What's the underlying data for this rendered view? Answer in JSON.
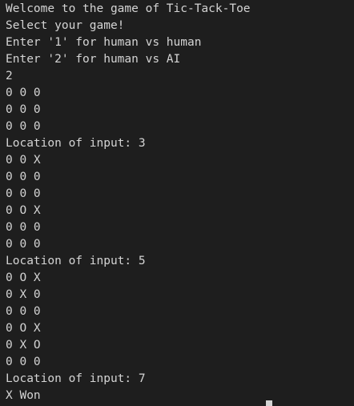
{
  "terminal": {
    "lines": [
      "Welcome to the game of Tic-Tack-Toe",
      "Select your game!",
      "Enter '1' for human vs human",
      "Enter '2' for human vs AI",
      "2",
      "0 0 0",
      "0 0 0",
      "0 0 0",
      "Location of input: 3",
      "0 0 X",
      "0 0 0",
      "0 0 0",
      "0 O X",
      "0 0 0",
      "0 0 0",
      "Location of input: 5",
      "0 O X",
      "0 X 0",
      "0 0 0",
      "0 O X",
      "0 X O",
      "0 0 0",
      "Location of input: 7",
      "X Won"
    ]
  }
}
